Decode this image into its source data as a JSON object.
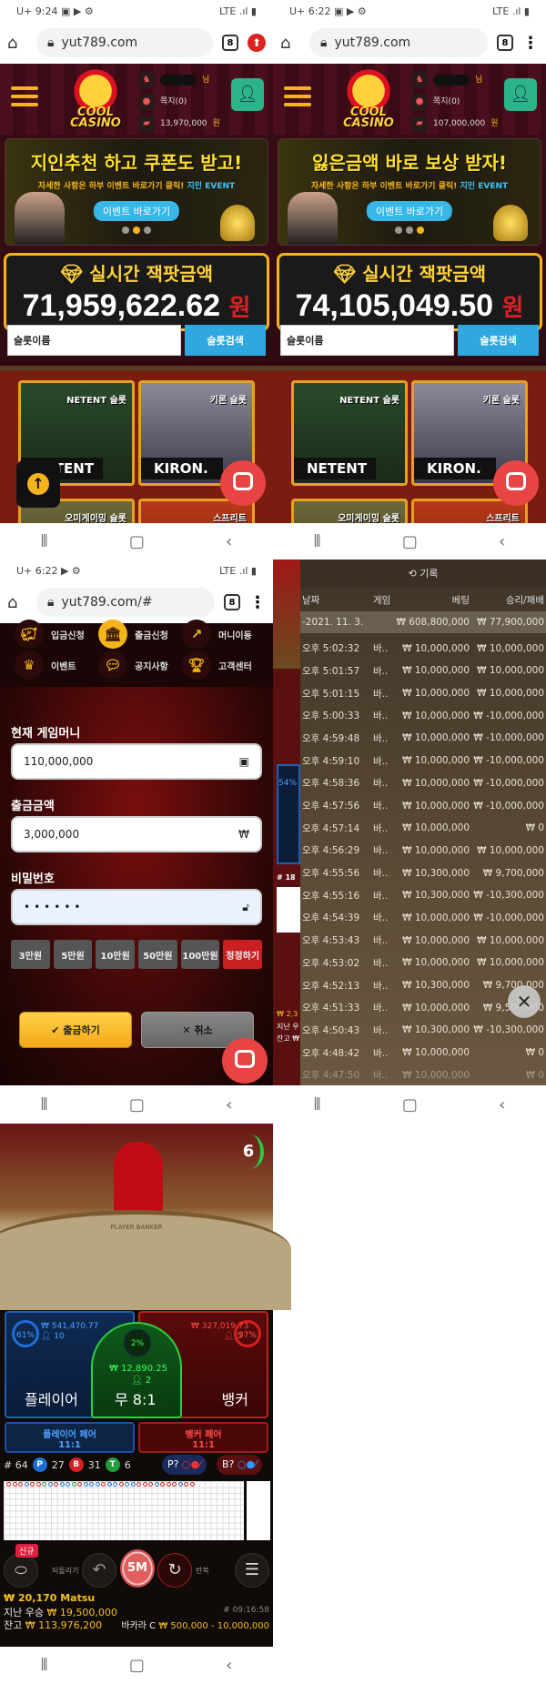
{
  "panel1": {
    "status_time": "9:24",
    "carrier": "U+",
    "url": "yut789.com",
    "tab_count": "8",
    "user": {
      "suffix": "님",
      "messages": "쪽지(0)",
      "balance": "13,970,000",
      "won": "원"
    },
    "logo_text": "COOL CASINO",
    "banner": {
      "title": "지인추천 하고 쿠폰도 받고!",
      "subtitle": "자세한 사항은 하부 이벤트 바로가기 클릭!",
      "subtitle_highlight": "지인 EVENT",
      "button": "이벤트 바로가기",
      "active_dot": 2
    },
    "jackpot": {
      "title": "실시간 잭팟금액",
      "value": "71,959,622.62",
      "unit": "원"
    },
    "search": {
      "placeholder": "슬롯이름",
      "button": "슬롯검색"
    },
    "tiles": [
      {
        "label": "NETENT 슬롯",
        "brand": "NETENT"
      },
      {
        "label": "키론 슬롯",
        "brand": "KIRON."
      },
      {
        "label": "오미게이밍 슬롯",
        "brand": ""
      },
      {
        "label": "스프리트",
        "brand": ""
      }
    ]
  },
  "panel2": {
    "status_time": "6:22",
    "carrier": "U+",
    "url": "yut789.com",
    "tab_count": "8",
    "user": {
      "suffix": "님",
      "messages": "쪽지(0)",
      "balance": "107,000,000",
      "won": "원"
    },
    "banner": {
      "title": "잃은금액 바로 보상 받자!",
      "subtitle": "자세한 사항은 하부 이벤트 바로가기 클릭!",
      "subtitle_highlight": "지인 EVENT",
      "button": "이벤트 바로가기",
      "active_dot": 3
    },
    "jackpot": {
      "title": "실시간 잭팟금액",
      "value": "74,105,049.50",
      "unit": "원"
    },
    "search": {
      "placeholder": "슬롯이름",
      "button": "슬롯검색"
    }
  },
  "wallet": {
    "status_time": "6:22",
    "carrier": "U+",
    "url": "yut789.com/#",
    "tab_count": "8",
    "menu": [
      "입금신청",
      "출금신청",
      "머니이동",
      "이벤트",
      "공지사항",
      "고객센터"
    ],
    "current_label": "현재 게임머니",
    "current_value": "110,000,000",
    "amount_label": "출금금액",
    "amount_value": "3,000,000",
    "amount_unit": "₩",
    "password_label": "비밀번호",
    "password_value": "••••••",
    "quick": [
      "3만원",
      "5만원",
      "10만원",
      "50만원",
      "100만원",
      "정정하기"
    ],
    "submit": "출금하기",
    "cancel": "취소"
  },
  "history": {
    "title": "기록",
    "headers": [
      "날짜",
      "게임",
      "베팅",
      "승리/패배"
    ],
    "total": {
      "date": "-2021. 11. 3.",
      "bet": "₩ 608,800,000",
      "result": "₩ 77,900,000"
    },
    "rows": [
      [
        "오후 5:02:32",
        "바..",
        "₩ 10,000,000",
        "₩ 10,000,000"
      ],
      [
        "오후 5:01:57",
        "바..",
        "₩ 10,000,000",
        "₩ 10,000,000"
      ],
      [
        "오후 5:01:15",
        "바..",
        "₩ 10,000,000",
        "₩ 10,000,000"
      ],
      [
        "오후 5:00:33",
        "바..",
        "₩ 10,000,000",
        "₩ -10,000,000"
      ],
      [
        "오후 4:59:48",
        "바..",
        "₩ 10,000,000",
        "₩ -10,000,000"
      ],
      [
        "오후 4:59:10",
        "바..",
        "₩ 10,000,000",
        "₩ -10,000,000"
      ],
      [
        "오후 4:58:36",
        "바..",
        "₩ 10,000,000",
        "₩ -10,000,000"
      ],
      [
        "오후 4:57:56",
        "바..",
        "₩ 10,000,000",
        "₩ -10,000,000"
      ],
      [
        "오후 4:57:14",
        "바..",
        "₩ 10,000,000",
        "₩ 0"
      ],
      [
        "오후 4:56:29",
        "바..",
        "₩ 10,000,000",
        "₩ 10,000,000"
      ],
      [
        "오후 4:55:56",
        "바..",
        "₩ 10,300,000",
        "₩ 9,700,000"
      ],
      [
        "오후 4:55:16",
        "바..",
        "₩ 10,300,000",
        "₩ -10,300,000"
      ],
      [
        "오후 4:54:39",
        "바..",
        "₩ 10,000,000",
        "₩ -10,000,000"
      ],
      [
        "오후 4:53:43",
        "바..",
        "₩ 10,000,000",
        "₩ 10,000,000"
      ],
      [
        "오후 4:53:02",
        "바..",
        "₩ 10,000,000",
        "₩ 10,000,000"
      ],
      [
        "오후 4:52:13",
        "바..",
        "₩ 10,300,000",
        "₩ 9,700,000"
      ],
      [
        "오후 4:51:33",
        "바..",
        "₩ 10,000,000",
        "₩ 9,500,000"
      ],
      [
        "오후 4:50:43",
        "바..",
        "₩ 10,300,000",
        "₩ -10,300,000"
      ],
      [
        "오후 4:48:42",
        "바..",
        "₩ 10,000,000",
        "₩ 0"
      ],
      [
        "오후 4:47:50",
        "바..",
        "₩ 10,000,000",
        "₩ 0"
      ]
    ],
    "behind": {
      "percent": "54%",
      "round": "# 18",
      "new_badge": "신",
      "line1": "₩ 2,3",
      "line2": "지난 우",
      "line3": "잔고 ₩"
    }
  },
  "baccarat": {
    "timer": "6",
    "table_text": "PLAYER  BANKER",
    "player": {
      "label": "플레이어",
      "percent": "61%",
      "amount": "₩ 541,470.77",
      "count": "10"
    },
    "tie": {
      "label": "무 8:1",
      "percent": "2%",
      "amount": "₩ 12,890.25",
      "count": "2"
    },
    "banker": {
      "label": "뱅커",
      "percent": "37%",
      "amount": "₩ 327,019.73",
      "count": "5"
    },
    "player_pair": {
      "label": "플레이어 페어",
      "odds": "11:1"
    },
    "banker_pair": {
      "label": "뱅커 페어",
      "odds": "11:1"
    },
    "round": "# 64",
    "counts": {
      "P": "27",
      "B": "31",
      "T": "6"
    },
    "ask_p": "P?",
    "ask_b": "B?",
    "new_badge": "신규",
    "undo": "되돌리기",
    "chip": "5M",
    "repeat": "반복",
    "win_line": "₩ 20,170 Matsu",
    "last_win_label": "지난 우승",
    "last_win": "₩ 19,500,000",
    "balance_label": "잔고",
    "balance": "₩ 113,976,200",
    "game_id": "# 09:16:58",
    "table_name": "바카라 C",
    "limits": "₩ 500,000 - 10,000,000",
    "road_top": "BBBPBBTPBPPTBPPPBPPBPPBBBPBBBPBB",
    "colors": {
      "player": "#1e6fd9",
      "banker": "#d42020",
      "tie": "#1f9e3c"
    }
  }
}
